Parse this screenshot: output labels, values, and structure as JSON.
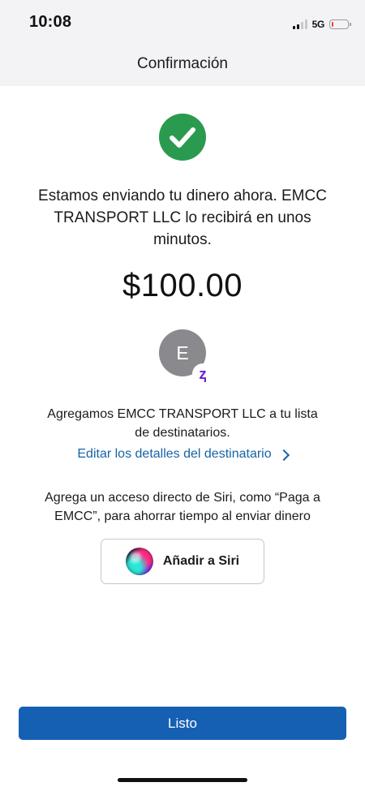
{
  "status_bar": {
    "time": "10:08",
    "network": "5G",
    "signal_bars_active": 2,
    "signal_bars_total": 4,
    "battery_level": 0.12,
    "battery_color": "#ff3b30"
  },
  "header": {
    "title": "Confirmación"
  },
  "success": {
    "icon": "checkmark-icon",
    "color": "#2a9a4f"
  },
  "message": "Estamos enviando tu dinero ahora. EMCC TRANSPORT LLC lo recibirá en unos minutos.",
  "amount": "$100.00",
  "recipient": {
    "initial": "E",
    "badge": "Z",
    "badge_color": "#6d1ed4"
  },
  "added_text": "Agregamos EMCC TRANSPORT LLC a tu lista de destinatarios.",
  "edit_link": {
    "label": "Editar los detalles del destinatario",
    "icon": "chevron-right-icon",
    "color": "#1763a6"
  },
  "siri": {
    "text": "Agrega un acceso directo de Siri, como “Paga a EMCC”, para ahorrar tiempo al enviar dinero",
    "button_label": "Añadir a Siri",
    "icon": "siri-icon"
  },
  "done_button": {
    "label": "Listo",
    "color": "#1660b4"
  }
}
